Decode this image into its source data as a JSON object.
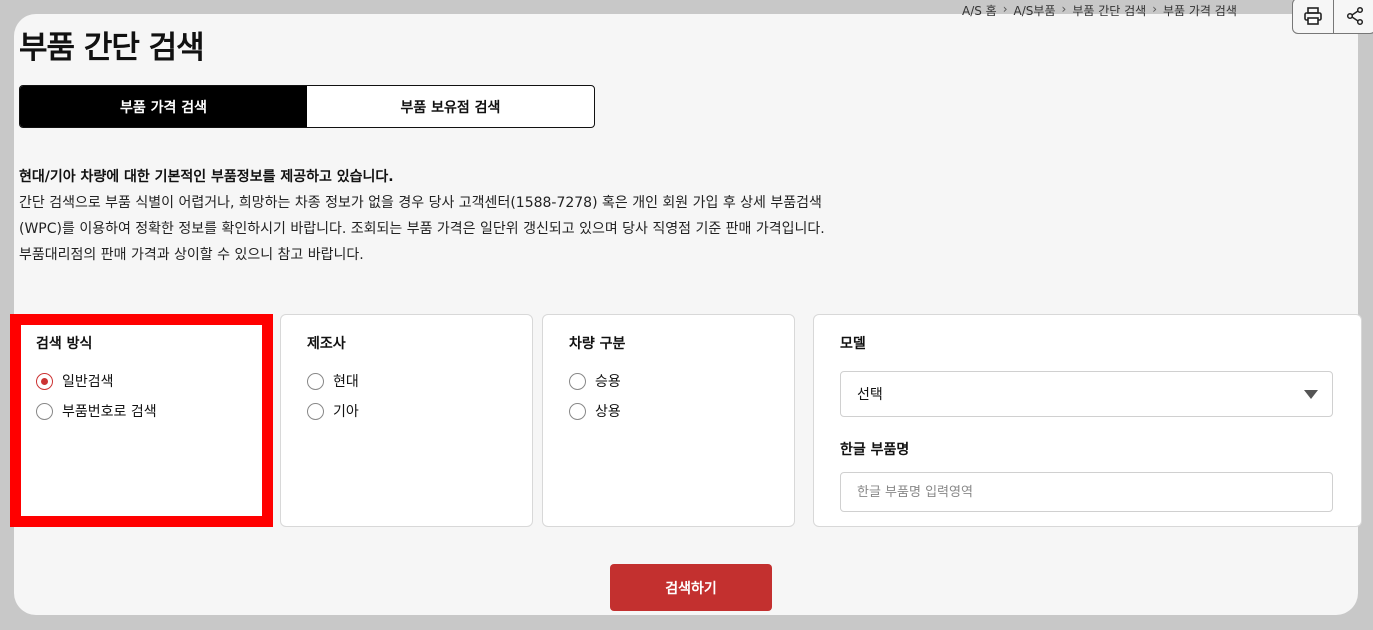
{
  "breadcrumb": [
    "A/S 홈",
    "A/S부품",
    "부품 간단 검색",
    "부품 가격 검색"
  ],
  "tools": {
    "print_icon": "printer-icon",
    "share_icon": "share-icon"
  },
  "page_title": "부품 간단 검색",
  "tabs": [
    {
      "label": "부품 가격 검색",
      "active": true
    },
    {
      "label": "부품 보유점 검색",
      "active": false
    }
  ],
  "intro": {
    "lead": "현대/기아 차량에 대한 기본적인 부품정보를 제공하고 있습니다.",
    "lines": [
      "간단 검색으로 부품 식별이 어렵거나, 희망하는 차종 정보가 없을 경우 당사 고객센터(1588-7278) 혹은 개인 회원 가입 후 상세 부품검색",
      "(WPC)를 이용하여 정확한 정보를 확인하시기 바랍니다. 조회되는 부품 가격은 일단위 갱신되고 있으며 당사 직영점 기준 판매 가격입니다.",
      "부품대리점의 판매 가격과 상이할 수 있으니 참고 바랍니다."
    ]
  },
  "search_method": {
    "label": "검색 방식",
    "options": [
      {
        "label": "일반검색",
        "checked": true
      },
      {
        "label": "부품번호로 검색",
        "checked": false
      }
    ]
  },
  "manufacturer": {
    "label": "제조사",
    "options": [
      {
        "label": "현대",
        "checked": false
      },
      {
        "label": "기아",
        "checked": false
      }
    ]
  },
  "vehicle_type": {
    "label": "차량 구분",
    "options": [
      {
        "label": "승용",
        "checked": false
      },
      {
        "label": "상용",
        "checked": false
      }
    ]
  },
  "model": {
    "label": "모델",
    "selected": "선택"
  },
  "part_name": {
    "label": "한글 부품명",
    "placeholder": "한글 부품명 입력영역",
    "value": ""
  },
  "search_button": "검색하기",
  "colors": {
    "accent": "#c3302f",
    "highlight": "#ff0000",
    "tab_active_bg": "#000000"
  }
}
